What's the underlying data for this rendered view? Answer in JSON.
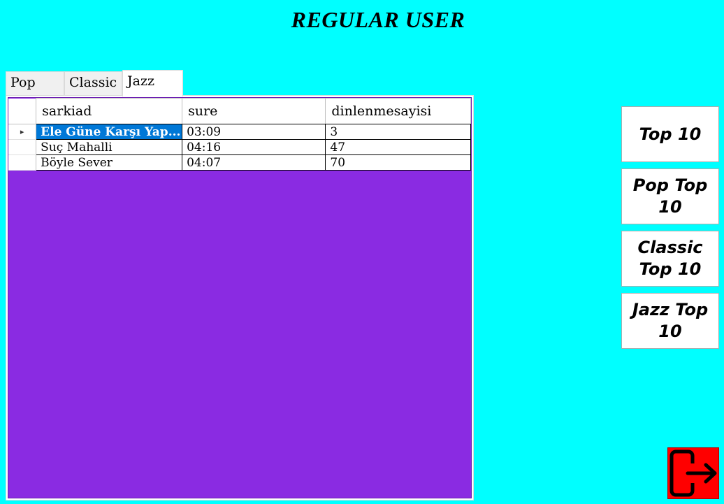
{
  "header": {
    "title": "REGULAR USER"
  },
  "tabs": [
    {
      "label": "Pop"
    },
    {
      "label": "Classic"
    },
    {
      "label": "Jazz"
    }
  ],
  "active_tab": "Jazz",
  "grid": {
    "columns": [
      "sarkiad",
      "sure",
      "dinlenmesayisi"
    ],
    "rows": [
      {
        "sarkiad": "Ele Güne Karşı Yap...",
        "sure": "03:09",
        "dinlenmesayisi": "3",
        "selected": true
      },
      {
        "sarkiad": "Suç Mahalli",
        "sure": "04:16",
        "dinlenmesayisi": "47"
      },
      {
        "sarkiad": "Böyle Sever",
        "sure": "04:07",
        "dinlenmesayisi": "70"
      }
    ],
    "row_header_glyph": "▸",
    "background_color": "#8A2BE2",
    "selection_color": "#0078D7"
  },
  "side_buttons": {
    "top10": "Top 10",
    "pop_top10": "Pop Top 10",
    "classic_top10": "Classic Top 10",
    "jazz_top10": "Jazz Top 10"
  },
  "exit_button": {
    "icon": "exit-icon",
    "color": "#FF0000"
  },
  "colors": {
    "background": "#00FFFF"
  }
}
